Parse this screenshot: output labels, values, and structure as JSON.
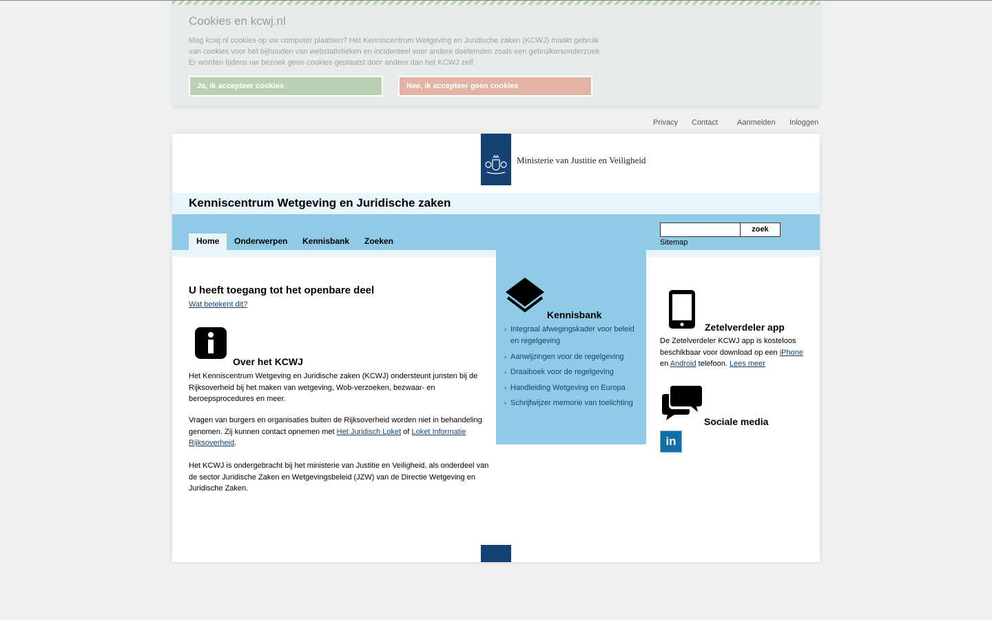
{
  "cookie": {
    "title": "Cookies en kcwj.nl",
    "text": "Mag kcwj.nl cookies op uw computer plaatsen? Het Kenniscentrum Wetgeving en Juridische zaken (KCWJ) maakt gebruik van cookies voor het bijhouden van webstatistieken en incidenteel voor andere doeleinden zoals een gebruikersonderzoek. Er worden tijdens uw bezoek geen cookies geplaatst door andere dan het KCWJ zelf.",
    "accept_label": "Ja, ik accepteer cookies",
    "decline_label": "Nee, ik accepteer geen cookies"
  },
  "util_links": {
    "privacy": "Privacy",
    "contact": "Contact",
    "register": "Aanmelden",
    "login": "Inloggen"
  },
  "header": {
    "ministry": "Ministerie van Justitie en Veiligheid",
    "site_title": "Kenniscentrum Wetgeving en Juridische zaken"
  },
  "nav": {
    "tabs": [
      "Home",
      "Onderwerpen",
      "Kennisbank",
      "Zoeken"
    ],
    "active": "Home",
    "search_button": "zoek",
    "search_value": "",
    "sitemap": "Sitemap"
  },
  "left": {
    "access_title": "U heeft toegang tot het openbare deel",
    "access_link": "Wat betekent dit?",
    "about_title": "Over het KCWJ",
    "p1": "Het Kenniscentrum Wetgeving en Juridische zaken (KCWJ) ondersteunt juristen bij de Rijksoverheid bij het maken van wetgeving, Wob-verzoeken, bezwaar- en beroepsprocedures en meer.",
    "p2_before": "Vragen van burgers en organisaties buiten de Rijksoverheid worden niet in behandeling genomen. Zij kunnen contact opnemen met ",
    "p2_link1": "Het Juridisch Loket",
    "p2_mid": " of ",
    "p2_link2": "Loket Informatie Rijksoverheid",
    "p2_after": ".",
    "p3": "Het KCWJ is ondergebracht bij het ministerie van Justitie en Veiligheid, als onderdeel van de sector Juridische Zaken en Wetgevingsbeleid (JZW) van de Directie Wetgeving en Juridische Zaken."
  },
  "kennisbank": {
    "title": "Kennisbank",
    "items": [
      "Integraal afwegingskader voor beleid en regelgeving",
      "Aanwijzingen voor de regelgeving",
      "Draaiboek voor de regelgeving",
      "Handleiding Wetgeving en Europa",
      "Schrijfwijzer memorie van toelichting"
    ]
  },
  "right": {
    "app_title": "Zetelverdeler app",
    "app_before": "De Zetelverdeler KCWJ app is kosteloos beschikbaar voor download op een ",
    "app_link_iphone": "iPhone",
    "app_mid1": " en ",
    "app_link_android": "Android",
    "app_mid2": " telefoon. ",
    "app_link_more": "Lees meer",
    "social_title": "Sociale media",
    "linkedin_label": "in"
  },
  "colors": {
    "rijks_blue": "#154273",
    "light_blue": "#8fcae7",
    "pale_blue": "#eaf4fb"
  },
  "icons": [
    "info-icon",
    "layers-icon",
    "phone-icon",
    "chat-icon",
    "linkedin-icon"
  ]
}
